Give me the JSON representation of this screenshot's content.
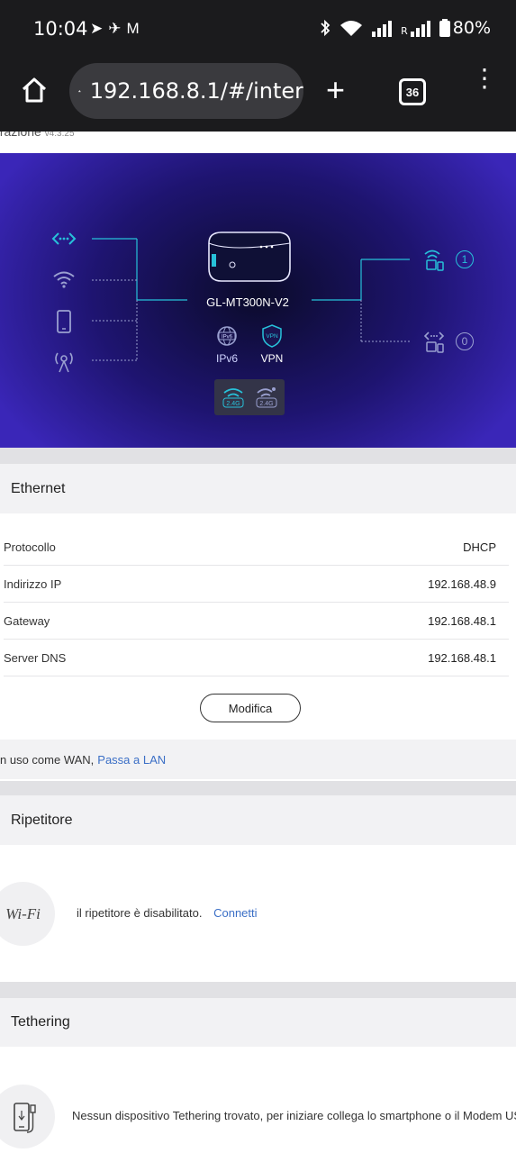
{
  "status_bar": {
    "time": "10:04",
    "left_icons": [
      "telegram-icon",
      "tools-icon",
      "gmail-icon"
    ],
    "right_icons": [
      "bluetooth-icon",
      "wifi-icon",
      "signal-icon",
      "roaming-signal-icon",
      "battery-icon"
    ],
    "roaming_label": "R",
    "battery": "80%"
  },
  "browser": {
    "url": "192.168.8.1/#/inter",
    "tab_count": "36"
  },
  "page_header": {
    "title_fragment": "trazione",
    "version": "v4.3.25"
  },
  "hero": {
    "model": "GL-MT300N-V2",
    "ipv6_badge": "IPv6",
    "ipv6_label": "IPv6",
    "vpn_badge": "VPN",
    "vpn_label": "VPN",
    "band_badge_1": "2.4G",
    "band_badge_2": "2.4G",
    "wireless_clients": "1",
    "wired_clients": "0",
    "colors": {
      "accent": "#27c1d9",
      "dim": "#9aa0d0"
    }
  },
  "ethernet": {
    "title": "Ethernet",
    "rows": [
      {
        "label": "Protocollo",
        "value": "DHCP"
      },
      {
        "label": "Indirizzo IP",
        "value": "192.168.48.9"
      },
      {
        "label": "Gateway",
        "value": "192.168.48.1"
      },
      {
        "label": "Server DNS",
        "value": "192.168.48.1"
      }
    ],
    "modify_button": "Modifica",
    "note_text": "n uso come WAN,",
    "note_link": "Passa a LAN"
  },
  "repeater": {
    "title": "Ripetitore",
    "icon_text": "Wi-Fi",
    "message": "il ripetitore è disabilitato.",
    "link": "Connetti"
  },
  "tethering": {
    "title": "Tethering",
    "message": "Nessun dispositivo Tethering trovato, per iniziare collega lo smartphone o il Modem USB"
  }
}
